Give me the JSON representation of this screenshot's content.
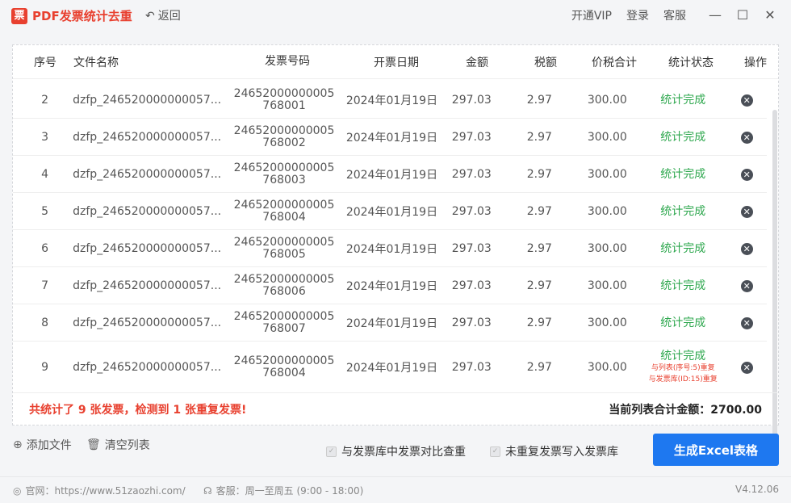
{
  "app": {
    "logo_glyph": "票",
    "title": "PDF发票统计去重",
    "back_label": "返回",
    "top_links": [
      "开通VIP",
      "登录",
      "客服"
    ],
    "window_controls": [
      "minimize-icon",
      "maximize-icon",
      "close-icon"
    ]
  },
  "table": {
    "headers": [
      "序号",
      "文件名称",
      "发票号码",
      "开票日期",
      "金额",
      "税额",
      "价税合计",
      "统计状态",
      "操作"
    ],
    "rows": [
      {
        "idx": "2",
        "file": "dzfp_246520000000057...",
        "no1": "24652000000005",
        "no2": "768001",
        "date": "2024年01月19日",
        "amount": "297.03",
        "tax": "2.97",
        "total": "300.00",
        "status": "统计完成"
      },
      {
        "idx": "3",
        "file": "dzfp_246520000000057...",
        "no1": "24652000000005",
        "no2": "768002",
        "date": "2024年01月19日",
        "amount": "297.03",
        "tax": "2.97",
        "total": "300.00",
        "status": "统计完成"
      },
      {
        "idx": "4",
        "file": "dzfp_246520000000057...",
        "no1": "24652000000005",
        "no2": "768003",
        "date": "2024年01月19日",
        "amount": "297.03",
        "tax": "2.97",
        "total": "300.00",
        "status": "统计完成"
      },
      {
        "idx": "5",
        "file": "dzfp_246520000000057...",
        "no1": "24652000000005",
        "no2": "768004",
        "date": "2024年01月19日",
        "amount": "297.03",
        "tax": "2.97",
        "total": "300.00",
        "status": "统计完成"
      },
      {
        "idx": "6",
        "file": "dzfp_246520000000057...",
        "no1": "24652000000005",
        "no2": "768005",
        "date": "2024年01月19日",
        "amount": "297.03",
        "tax": "2.97",
        "total": "300.00",
        "status": "统计完成"
      },
      {
        "idx": "7",
        "file": "dzfp_246520000000057...",
        "no1": "24652000000005",
        "no2": "768006",
        "date": "2024年01月19日",
        "amount": "297.03",
        "tax": "2.97",
        "total": "300.00",
        "status": "统计完成"
      },
      {
        "idx": "8",
        "file": "dzfp_246520000000057...",
        "no1": "24652000000005",
        "no2": "768007",
        "date": "2024年01月19日",
        "amount": "297.03",
        "tax": "2.97",
        "total": "300.00",
        "status": "统计完成"
      },
      {
        "idx": "9",
        "file": "dzfp_246520000000057...",
        "no1": "24652000000005",
        "no2": "768004",
        "date": "2024年01月19日",
        "amount": "297.03",
        "tax": "2.97",
        "total": "300.00",
        "status": "统计完成",
        "dup1": "与列表(序号:5)重复",
        "dup2": "与发票库(ID:15)重复"
      }
    ]
  },
  "summary": {
    "left": "共统计了 9 张发票，检测到 1 张重复发票!",
    "right": "当前列表合计金额：2700.00"
  },
  "actions": {
    "add_file": "添加文件",
    "clear_list": "清空列表",
    "compare_db": "与发票库中发票对比查重",
    "write_db": "未重复发票写入发票库",
    "generate": "生成Excel表格"
  },
  "footer": {
    "website": "官网：https://www.51zaozhi.com/",
    "service": "客服：周一至周五 (9:00 - 18:00)",
    "version": "V4.12.06"
  },
  "colors": {
    "brand_red": "#e8402f",
    "primary_blue": "#1e78f0",
    "status_green": "#2fa84f"
  }
}
